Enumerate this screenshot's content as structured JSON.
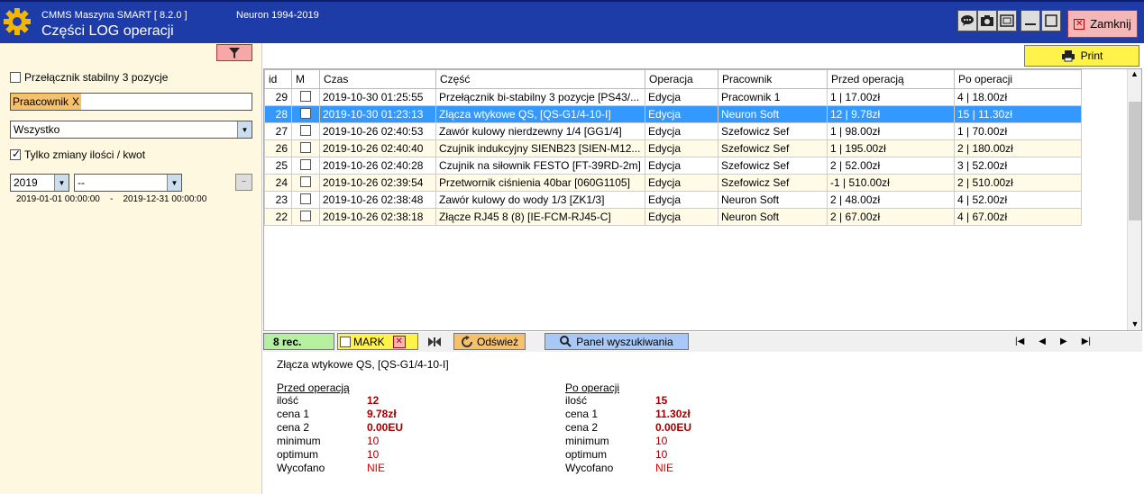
{
  "header": {
    "app_name": "CMMS Maszyna SMART  [  8.2.0 ]",
    "copyright": "Neuron 1994-2019",
    "title": "Części LOG operacji",
    "close_label": "Zamknij"
  },
  "filters": {
    "stable_switch_label": "Przełącznik stabilny 3 pozycje",
    "worker_tag": "Praacownik",
    "worker_tag_remove": "X",
    "scope_value": "Wszystko",
    "only_changes_label": "Tylko zmiany ilości / kwot",
    "year_value": "2019",
    "month_value": "--",
    "dots_label": "..",
    "date_from": "2019-01-01   00:00:00",
    "date_sep": "-",
    "date_to": "2019-12-31   00:00:00"
  },
  "toolbar": {
    "print_label": "Print"
  },
  "table": {
    "columns": [
      "id",
      "M",
      "Czas",
      "Część",
      "Operacja",
      "Pracownik",
      "Przed operacją",
      "Po operacji"
    ],
    "rows": [
      {
        "id": "29",
        "czas": "2019-10-30  01:25:55",
        "czesc": "Przełącznik  bi-stabilny 3 pozycje [PS43/...",
        "operacja": "Edycja",
        "pracownik": "Pracownik 1",
        "przed": "1  |  17.00zł",
        "po": "4  |  18.00zł"
      },
      {
        "id": "28",
        "czas": "2019-10-30  01:23:13",
        "czesc": "Złącza wtykowe QS, [QS-G1/4-10-I]",
        "operacja": "Edycja",
        "pracownik": "Neuron Soft",
        "przed": "12  |  9.78zł",
        "po": "15  |  11.30zł"
      },
      {
        "id": "27",
        "czas": "2019-10-26  02:40:53",
        "czesc": "Zawór kulowy nierdzewny 1/4 [GG1/4]",
        "operacja": "Edycja",
        "pracownik": "Szefowicz Sef",
        "przed": "1  |  98.00zł",
        "po": "1  |  70.00zł"
      },
      {
        "id": "26",
        "czas": "2019-10-26  02:40:40",
        "czesc": "Czujnik indukcyjny SIENB23 [SIEN-M12...",
        "operacja": "Edycja",
        "pracownik": "Szefowicz Sef",
        "przed": "1  |  195.00zł",
        "po": "2  |  180.00zł"
      },
      {
        "id": "25",
        "czas": "2019-10-26  02:40:28",
        "czesc": "Czujnik na siłownik FESTO [FT-39RD-2m]",
        "operacja": "Edycja",
        "pracownik": "Szefowicz Sef",
        "przed": "2  |  52.00zł",
        "po": "3  |  52.00zł"
      },
      {
        "id": "24",
        "czas": "2019-10-26  02:39:54",
        "czesc": "Przetwornik ciśnienia 40bar [060G1105]",
        "operacja": "Edycja",
        "pracownik": "Szefowicz Sef",
        "przed": "-1  |  510.00zł",
        "po": "2  |  510.00zł"
      },
      {
        "id": "23",
        "czas": "2019-10-26  02:38:48",
        "czesc": "Zawór kulowy do wody 1/3 [ZK1/3]",
        "operacja": "Edycja",
        "pracownik": "Neuron Soft",
        "przed": "2  |  48.00zł",
        "po": "4  |  52.00zł"
      },
      {
        "id": "22",
        "czas": "2019-10-26  02:38:18",
        "czesc": "Złącze RJ45 8 (8) [IE-FCM-RJ45-C]",
        "operacja": "Edycja",
        "pracownik": "Neuron Soft",
        "przed": "2  |  67.00zł",
        "po": "4  |  67.00zł"
      }
    ]
  },
  "status": {
    "records": "8 rec.",
    "mark_label": "MARK",
    "refresh_label": "Odśwież",
    "search_panel_label": "Panel wyszukiwania"
  },
  "details": {
    "title": "Złącza wtykowe QS, [QS-G1/4-10-I]",
    "before": {
      "heading": "Przed operacją",
      "rows": [
        {
          "label": "ilość",
          "value": "12"
        },
        {
          "label": "cena 1",
          "value": "9.78zł"
        },
        {
          "label": "cena 2",
          "value": "0.00EU"
        },
        {
          "label": "minimum",
          "value": "10"
        },
        {
          "label": "optimum",
          "value": "10"
        },
        {
          "label": "Wycofano",
          "value": "NIE"
        }
      ]
    },
    "after": {
      "heading": "Po operacji",
      "rows": [
        {
          "label": "ilość",
          "value": "15"
        },
        {
          "label": "cena 1",
          "value": "11.30zł"
        },
        {
          "label": "cena 2",
          "value": "0.00EU"
        },
        {
          "label": "minimum",
          "value": "10"
        },
        {
          "label": "optimum",
          "value": "10"
        },
        {
          "label": "Wycofano",
          "value": "NIE"
        }
      ]
    }
  },
  "colors": {
    "titlebar": "#1e3ca8",
    "selected_row": "#3399ff",
    "value_red": "#a00000"
  }
}
